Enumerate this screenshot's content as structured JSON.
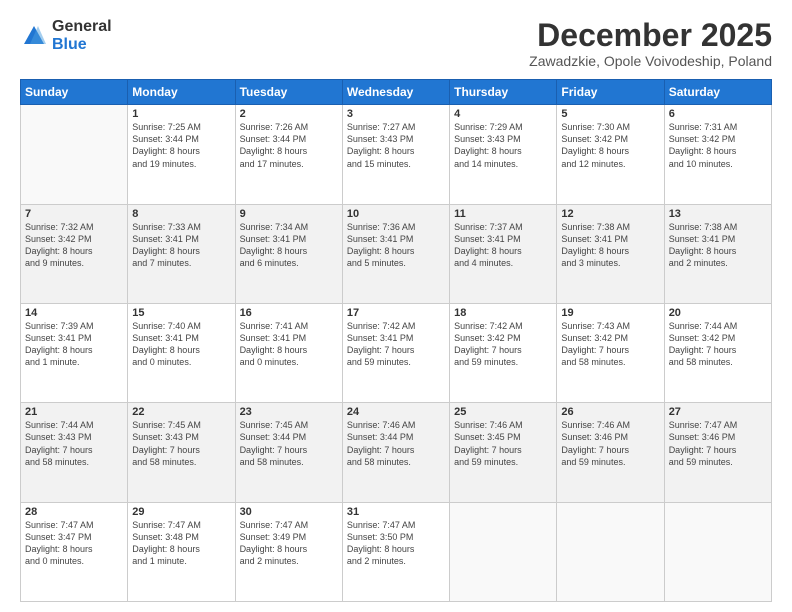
{
  "logo": {
    "general": "General",
    "blue": "Blue"
  },
  "header": {
    "month": "December 2025",
    "location": "Zawadzkie, Opole Voivodeship, Poland"
  },
  "weekdays": [
    "Sunday",
    "Monday",
    "Tuesday",
    "Wednesday",
    "Thursday",
    "Friday",
    "Saturday"
  ],
  "weeks": [
    [
      {
        "day": "",
        "info": ""
      },
      {
        "day": "1",
        "info": "Sunrise: 7:25 AM\nSunset: 3:44 PM\nDaylight: 8 hours\nand 19 minutes."
      },
      {
        "day": "2",
        "info": "Sunrise: 7:26 AM\nSunset: 3:44 PM\nDaylight: 8 hours\nand 17 minutes."
      },
      {
        "day": "3",
        "info": "Sunrise: 7:27 AM\nSunset: 3:43 PM\nDaylight: 8 hours\nand 15 minutes."
      },
      {
        "day": "4",
        "info": "Sunrise: 7:29 AM\nSunset: 3:43 PM\nDaylight: 8 hours\nand 14 minutes."
      },
      {
        "day": "5",
        "info": "Sunrise: 7:30 AM\nSunset: 3:42 PM\nDaylight: 8 hours\nand 12 minutes."
      },
      {
        "day": "6",
        "info": "Sunrise: 7:31 AM\nSunset: 3:42 PM\nDaylight: 8 hours\nand 10 minutes."
      }
    ],
    [
      {
        "day": "7",
        "info": "Sunrise: 7:32 AM\nSunset: 3:42 PM\nDaylight: 8 hours\nand 9 minutes."
      },
      {
        "day": "8",
        "info": "Sunrise: 7:33 AM\nSunset: 3:41 PM\nDaylight: 8 hours\nand 7 minutes."
      },
      {
        "day": "9",
        "info": "Sunrise: 7:34 AM\nSunset: 3:41 PM\nDaylight: 8 hours\nand 6 minutes."
      },
      {
        "day": "10",
        "info": "Sunrise: 7:36 AM\nSunset: 3:41 PM\nDaylight: 8 hours\nand 5 minutes."
      },
      {
        "day": "11",
        "info": "Sunrise: 7:37 AM\nSunset: 3:41 PM\nDaylight: 8 hours\nand 4 minutes."
      },
      {
        "day": "12",
        "info": "Sunrise: 7:38 AM\nSunset: 3:41 PM\nDaylight: 8 hours\nand 3 minutes."
      },
      {
        "day": "13",
        "info": "Sunrise: 7:38 AM\nSunset: 3:41 PM\nDaylight: 8 hours\nand 2 minutes."
      }
    ],
    [
      {
        "day": "14",
        "info": "Sunrise: 7:39 AM\nSunset: 3:41 PM\nDaylight: 8 hours\nand 1 minute."
      },
      {
        "day": "15",
        "info": "Sunrise: 7:40 AM\nSunset: 3:41 PM\nDaylight: 8 hours\nand 0 minutes."
      },
      {
        "day": "16",
        "info": "Sunrise: 7:41 AM\nSunset: 3:41 PM\nDaylight: 8 hours\nand 0 minutes."
      },
      {
        "day": "17",
        "info": "Sunrise: 7:42 AM\nSunset: 3:41 PM\nDaylight: 7 hours\nand 59 minutes."
      },
      {
        "day": "18",
        "info": "Sunrise: 7:42 AM\nSunset: 3:42 PM\nDaylight: 7 hours\nand 59 minutes."
      },
      {
        "day": "19",
        "info": "Sunrise: 7:43 AM\nSunset: 3:42 PM\nDaylight: 7 hours\nand 58 minutes."
      },
      {
        "day": "20",
        "info": "Sunrise: 7:44 AM\nSunset: 3:42 PM\nDaylight: 7 hours\nand 58 minutes."
      }
    ],
    [
      {
        "day": "21",
        "info": "Sunrise: 7:44 AM\nSunset: 3:43 PM\nDaylight: 7 hours\nand 58 minutes."
      },
      {
        "day": "22",
        "info": "Sunrise: 7:45 AM\nSunset: 3:43 PM\nDaylight: 7 hours\nand 58 minutes."
      },
      {
        "day": "23",
        "info": "Sunrise: 7:45 AM\nSunset: 3:44 PM\nDaylight: 7 hours\nand 58 minutes."
      },
      {
        "day": "24",
        "info": "Sunrise: 7:46 AM\nSunset: 3:44 PM\nDaylight: 7 hours\nand 58 minutes."
      },
      {
        "day": "25",
        "info": "Sunrise: 7:46 AM\nSunset: 3:45 PM\nDaylight: 7 hours\nand 59 minutes."
      },
      {
        "day": "26",
        "info": "Sunrise: 7:46 AM\nSunset: 3:46 PM\nDaylight: 7 hours\nand 59 minutes."
      },
      {
        "day": "27",
        "info": "Sunrise: 7:47 AM\nSunset: 3:46 PM\nDaylight: 7 hours\nand 59 minutes."
      }
    ],
    [
      {
        "day": "28",
        "info": "Sunrise: 7:47 AM\nSunset: 3:47 PM\nDaylight: 8 hours\nand 0 minutes."
      },
      {
        "day": "29",
        "info": "Sunrise: 7:47 AM\nSunset: 3:48 PM\nDaylight: 8 hours\nand 1 minute."
      },
      {
        "day": "30",
        "info": "Sunrise: 7:47 AM\nSunset: 3:49 PM\nDaylight: 8 hours\nand 2 minutes."
      },
      {
        "day": "31",
        "info": "Sunrise: 7:47 AM\nSunset: 3:50 PM\nDaylight: 8 hours\nand 2 minutes."
      },
      {
        "day": "",
        "info": ""
      },
      {
        "day": "",
        "info": ""
      },
      {
        "day": "",
        "info": ""
      }
    ]
  ]
}
